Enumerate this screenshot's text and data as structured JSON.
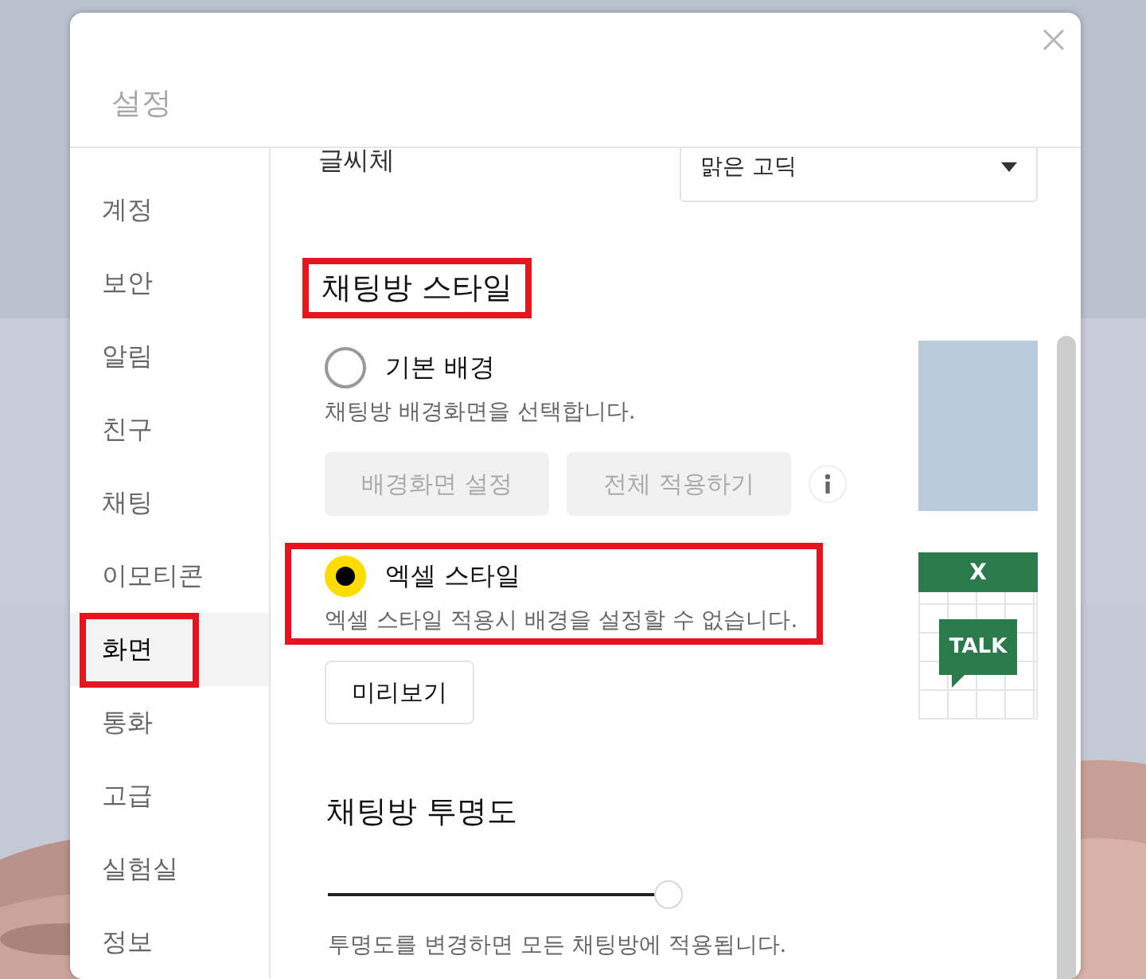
{
  "window": {
    "title": "설정"
  },
  "sidebar": {
    "items": [
      {
        "label": "계정",
        "selected": false,
        "highlighted": false
      },
      {
        "label": "보안",
        "selected": false,
        "highlighted": false
      },
      {
        "label": "알림",
        "selected": false,
        "highlighted": false
      },
      {
        "label": "친구",
        "selected": false,
        "highlighted": false
      },
      {
        "label": "채팅",
        "selected": false,
        "highlighted": false
      },
      {
        "label": "이모티콘",
        "selected": false,
        "highlighted": false
      },
      {
        "label": "화면",
        "selected": true,
        "highlighted": true
      },
      {
        "label": "통화",
        "selected": false,
        "highlighted": false
      },
      {
        "label": "고급",
        "selected": false,
        "highlighted": false
      },
      {
        "label": "실험실",
        "selected": false,
        "highlighted": false
      },
      {
        "label": "정보",
        "selected": false,
        "highlighted": false
      }
    ]
  },
  "font_setting": {
    "label": "글씨체",
    "value": "맑은 고딕"
  },
  "chat_style": {
    "title": "채팅방 스타일",
    "highlighted": true,
    "options": [
      {
        "kind": "background",
        "label": "기본 배경",
        "description": "채팅방 배경화면을 선택합니다.",
        "selected": false,
        "highlighted": false,
        "buttons": [
          {
            "label": "배경화면 설정",
            "disabled": true
          },
          {
            "label": "전체 적용하기",
            "disabled": true
          }
        ],
        "info": true
      },
      {
        "kind": "excel",
        "label": "엑셀 스타일",
        "description": "엑셀 스타일 적용시 배경을 설정할 수 없습니다.",
        "selected": true,
        "highlighted": true,
        "buttons": [
          {
            "label": "미리보기",
            "disabled": false
          }
        ],
        "preview_header": "X",
        "preview_badge": "TALK"
      }
    ]
  },
  "transparency": {
    "title": "채팅방 투명도",
    "level": 0.96,
    "description": "투명도를 변경하면 모든 채팅방에 적용됩니다."
  }
}
